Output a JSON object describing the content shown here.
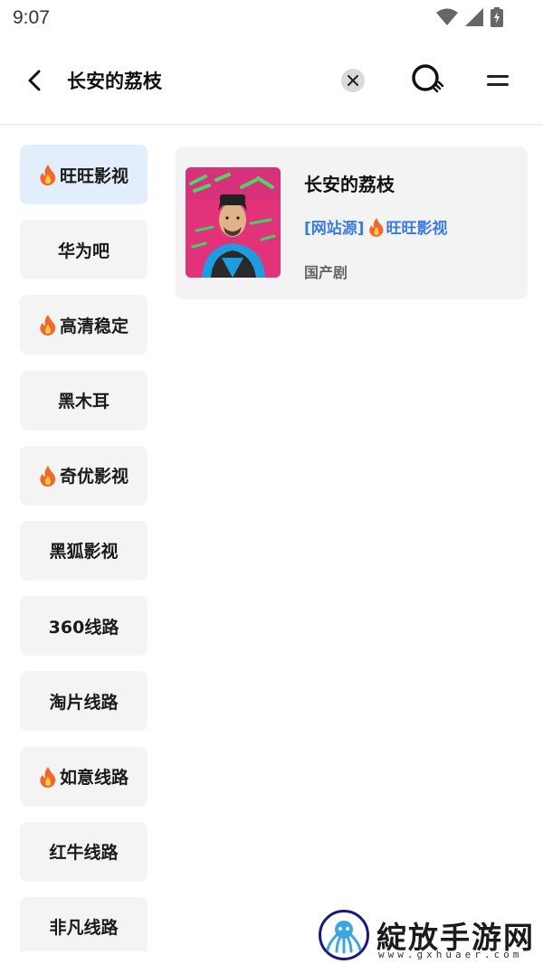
{
  "status_bar": {
    "time": "9:07"
  },
  "header": {
    "query": "长安的荔枝"
  },
  "sources": [
    {
      "label": "旺旺影视",
      "hot": true,
      "active": true
    },
    {
      "label": "华为吧",
      "hot": false,
      "active": false
    },
    {
      "label": "高清稳定",
      "hot": true,
      "active": false
    },
    {
      "label": "黑木耳",
      "hot": false,
      "active": false
    },
    {
      "label": "奇优影视",
      "hot": true,
      "active": false
    },
    {
      "label": "黑狐影视",
      "hot": false,
      "active": false
    },
    {
      "label": "360线路",
      "hot": false,
      "active": false
    },
    {
      "label": "淘片线路",
      "hot": false,
      "active": false
    },
    {
      "label": "如意线路",
      "hot": true,
      "active": false
    },
    {
      "label": "红牛线路",
      "hot": false,
      "active": false
    },
    {
      "label": "非凡线路",
      "hot": false,
      "active": false
    }
  ],
  "result": {
    "title": "长安的荔枝",
    "source_tag": "[网站源]",
    "source_name": "旺旺影视",
    "genre": "国产剧"
  },
  "watermark": {
    "text": "綻放手游网",
    "url": "www.gxhuaer.com"
  },
  "colors": {
    "accent": "#3a7be0",
    "active_bg": "#e3eefc",
    "item_bg": "#f4f4f4",
    "fire": "#f0682a"
  }
}
